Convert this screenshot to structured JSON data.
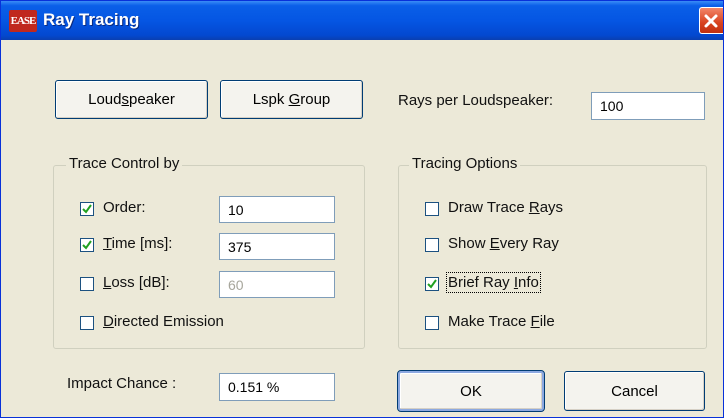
{
  "window": {
    "title": "Ray Tracing",
    "app_icon_text": "EASE"
  },
  "buttons": {
    "loudspeaker": {
      "pre": "Loud",
      "key": "s",
      "post": "peaker"
    },
    "lspk_group": {
      "pre": "Lspk ",
      "key": "G",
      "post": "roup"
    },
    "ok": "OK",
    "cancel": "Cancel"
  },
  "rays_per_loudspeaker": {
    "label": "Rays per Loudspeaker:",
    "value": "100"
  },
  "trace_control": {
    "title": "Trace Control by",
    "order": {
      "label": "Order:",
      "checked": true,
      "value": "10"
    },
    "time": {
      "key": "T",
      "label_rest": "ime [ms]:",
      "checked": true,
      "value": "375"
    },
    "loss": {
      "key": "L",
      "label_rest": "oss [dB]:",
      "checked": false,
      "value": "60"
    },
    "directed": {
      "key": "D",
      "label_rest": "irected Emission",
      "checked": false
    }
  },
  "tracing_options": {
    "title": "Tracing Options",
    "draw_trace_rays": {
      "pre": "Draw Trace ",
      "key": "R",
      "post": "ays",
      "checked": false
    },
    "show_every_ray": {
      "pre": "Show ",
      "key": "E",
      "post": "very Ray",
      "checked": false
    },
    "brief_ray_info": {
      "pre": "Brief Ray ",
      "key": "I",
      "post": "nfo",
      "checked": true
    },
    "make_trace_file": {
      "pre": "Make Trace ",
      "key": "F",
      "post": "ile",
      "checked": false
    }
  },
  "impact_chance": {
    "label": "Impact Chance :",
    "value": "0.151 %"
  }
}
